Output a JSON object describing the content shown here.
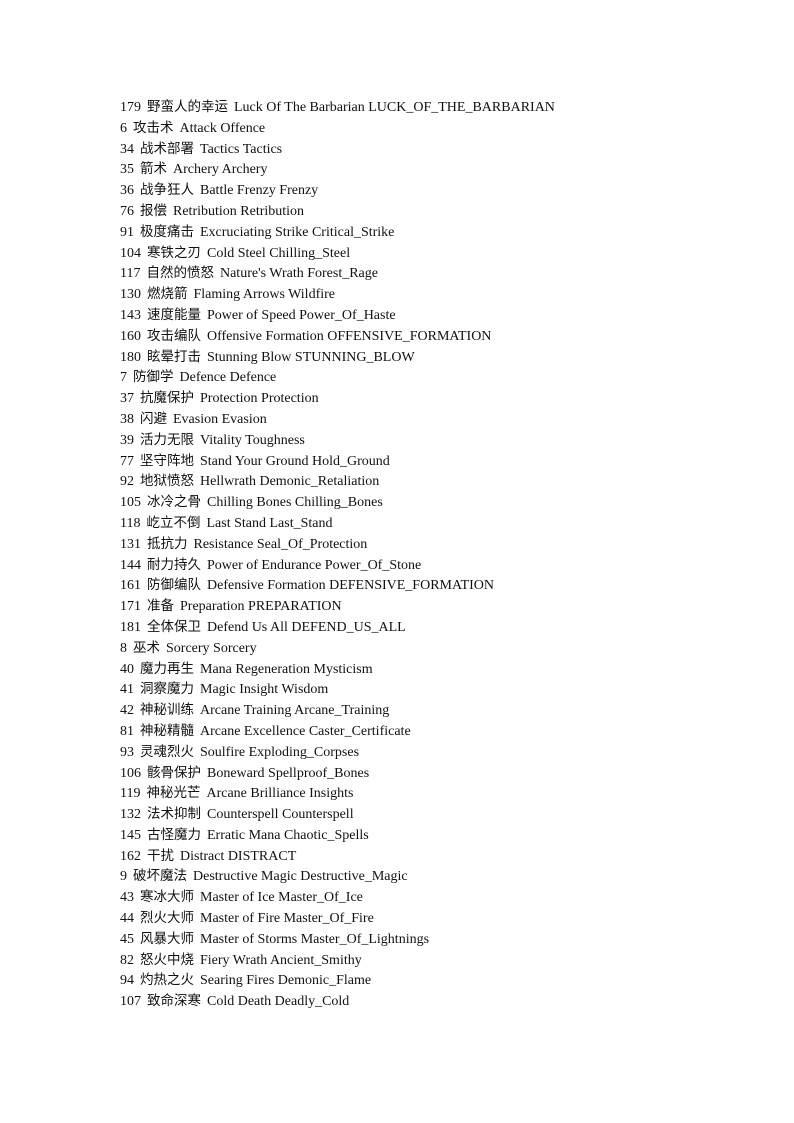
{
  "document": {
    "entries": [
      {
        "id": "179",
        "zh": "野蛮人的幸运",
        "en": "Luck Of The Barbarian LUCK_OF_THE_BARBARIAN"
      },
      {
        "id": "6",
        "zh": "攻击术",
        "en": "Attack Offence"
      },
      {
        "id": "34",
        "zh": "战术部署",
        "en": "Tactics Tactics"
      },
      {
        "id": "35",
        "zh": "箭术",
        "en": "Archery Archery"
      },
      {
        "id": "36",
        "zh": "战争狂人",
        "en": "Battle Frenzy Frenzy"
      },
      {
        "id": "76",
        "zh": "报偿",
        "en": "Retribution Retribution"
      },
      {
        "id": "91",
        "zh": "极度痛击",
        "en": "Excruciating Strike Critical_Strike"
      },
      {
        "id": "104",
        "zh": "寒铁之刃",
        "en": "Cold Steel Chilling_Steel"
      },
      {
        "id": "117",
        "zh": "自然的愤怒",
        "en": "Nature's Wrath Forest_Rage"
      },
      {
        "id": "130",
        "zh": "燃烧箭",
        "en": "Flaming Arrows Wildfire"
      },
      {
        "id": "143",
        "zh": "速度能量",
        "en": "Power of Speed Power_Of_Haste"
      },
      {
        "id": "160",
        "zh": "攻击编队",
        "en": "Offensive Formation OFFENSIVE_FORMATION"
      },
      {
        "id": "180",
        "zh": "眩晕打击",
        "en": "Stunning Blow STUNNING_BLOW"
      },
      {
        "id": "7",
        "zh": "防御学",
        "en": "Defence Defence"
      },
      {
        "id": "37",
        "zh": "抗魔保护",
        "en": "Protection Protection"
      },
      {
        "id": "38",
        "zh": "闪避",
        "en": "Evasion Evasion"
      },
      {
        "id": "39",
        "zh": "活力无限",
        "en": "Vitality Toughness"
      },
      {
        "id": "77",
        "zh": "坚守阵地",
        "en": "Stand Your Ground Hold_Ground"
      },
      {
        "id": "92",
        "zh": "地狱愤怒",
        "en": "Hellwrath Demonic_Retaliation"
      },
      {
        "id": "105",
        "zh": "冰冷之骨",
        "en": "Chilling Bones Chilling_Bones"
      },
      {
        "id": "118",
        "zh": "屹立不倒",
        "en": "Last Stand Last_Stand"
      },
      {
        "id": "131",
        "zh": "抵抗力",
        "en": "Resistance Seal_Of_Protection"
      },
      {
        "id": "144",
        "zh": "耐力持久",
        "en": "Power of Endurance Power_Of_Stone"
      },
      {
        "id": "161",
        "zh": "防御编队",
        "en": "Defensive Formation DEFENSIVE_FORMATION"
      },
      {
        "id": "171",
        "zh": "准备",
        "en": "Preparation PREPARATION"
      },
      {
        "id": "181",
        "zh": "全体保卫",
        "en": "Defend Us All DEFEND_US_ALL"
      },
      {
        "id": "8",
        "zh": "巫术",
        "en": "Sorcery Sorcery"
      },
      {
        "id": "40",
        "zh": "魔力再生",
        "en": "Mana Regeneration Mysticism"
      },
      {
        "id": "41",
        "zh": "洞察魔力",
        "en": "Magic Insight Wisdom"
      },
      {
        "id": "42",
        "zh": "神秘训练",
        "en": "Arcane Training Arcane_Training"
      },
      {
        "id": "81",
        "zh": "神秘精髓",
        "en": "Arcane Excellence Caster_Certificate"
      },
      {
        "id": "93",
        "zh": "灵魂烈火",
        "en": "Soulfire Exploding_Corpses"
      },
      {
        "id": "106",
        "zh": "骸骨保护",
        "en": "Boneward Spellproof_Bones"
      },
      {
        "id": "119",
        "zh": "神秘光芒",
        "en": "Arcane Brilliance Insights"
      },
      {
        "id": "132",
        "zh": "法术抑制",
        "en": "Counterspell Counterspell"
      },
      {
        "id": "145",
        "zh": "古怪魔力",
        "en": "Erratic Mana Chaotic_Spells"
      },
      {
        "id": "162",
        "zh": "干扰",
        "en": "Distract DISTRACT"
      },
      {
        "id": "9",
        "zh": "破坏魔法",
        "en": "Destructive Magic Destructive_Magic"
      },
      {
        "id": "43",
        "zh": "寒冰大师",
        "en": "Master of Ice Master_Of_Ice"
      },
      {
        "id": "44",
        "zh": "烈火大师",
        "en": "Master of Fire Master_Of_Fire"
      },
      {
        "id": "45",
        "zh": "风暴大师",
        "en": "Master of Storms Master_Of_Lightnings"
      },
      {
        "id": "82",
        "zh": "怒火中烧",
        "en": "Fiery Wrath Ancient_Smithy"
      },
      {
        "id": "94",
        "zh": "灼热之火",
        "en": "Searing Fires Demonic_Flame"
      },
      {
        "id": "107",
        "zh": "致命深寒",
        "en": "Cold Death Deadly_Cold"
      }
    ]
  }
}
